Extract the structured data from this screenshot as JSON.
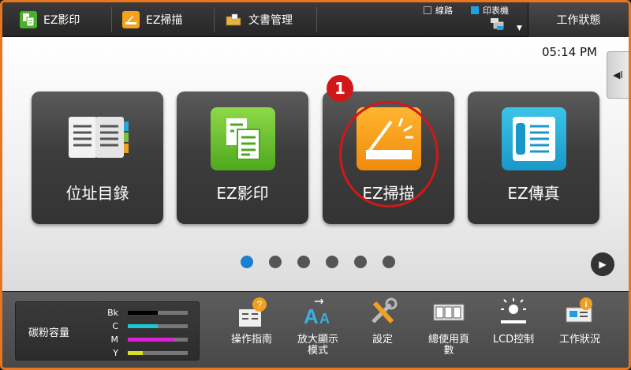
{
  "topbar": {
    "tabs": [
      {
        "label": "EZ影印",
        "icon": "copy-icon"
      },
      {
        "label": "EZ掃描",
        "icon": "scan-icon"
      },
      {
        "label": "文書管理",
        "icon": "folder-icon"
      }
    ],
    "status": {
      "line_label": "線路",
      "printer_label": "印表機"
    },
    "work_status_label": "工作狀態"
  },
  "main": {
    "time": "05:14 PM",
    "tiles": [
      {
        "label": "位址目錄",
        "icon": "address-book-icon"
      },
      {
        "label": "EZ影印",
        "icon": "copy-icon"
      },
      {
        "label": "EZ掃描",
        "icon": "scan-icon"
      },
      {
        "label": "EZ傳真",
        "icon": "fax-icon"
      }
    ],
    "callout_number": "1",
    "page_count": 6,
    "active_page": 1
  },
  "bottom": {
    "toner": {
      "label": "碳粉容量",
      "levels": [
        {
          "name": "Bk",
          "level": 0.5,
          "color": "#000000"
        },
        {
          "name": "C",
          "level": 0.5,
          "color": "#1ec8d2"
        },
        {
          "name": "M",
          "level": 0.78,
          "color": "#e020d8"
        },
        {
          "name": "Y",
          "level": 0.25,
          "color": "#d8e020"
        }
      ]
    },
    "items": [
      {
        "label": "操作指南",
        "icon": "guide-icon"
      },
      {
        "label": "放大顯示\n模式",
        "icon": "magnify-display-icon"
      },
      {
        "label": "設定",
        "icon": "settings-tools-icon"
      },
      {
        "label": "總使用頁\n數",
        "icon": "counter-icon"
      },
      {
        "label": "LCD控制",
        "icon": "brightness-icon"
      },
      {
        "label": "工作狀況",
        "icon": "job-status-icon"
      }
    ]
  },
  "colors": {
    "accent_frame": "#e8761e",
    "callout": "#d01818",
    "active_dot": "#1c7fd1"
  }
}
